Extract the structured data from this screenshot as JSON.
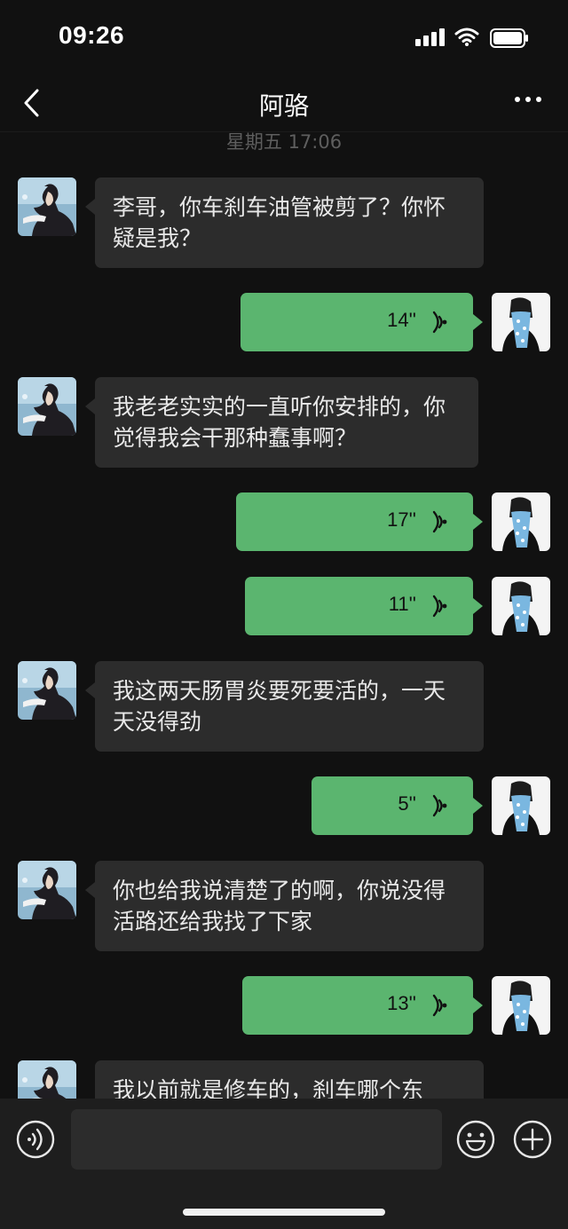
{
  "status_bar": {
    "time": "09:26"
  },
  "header": {
    "title": "阿骆"
  },
  "chat": {
    "timestamp": "星期五 17:06",
    "messages": [
      {
        "side": "left",
        "text": "李哥，你车刹车油管被剪了？你怀疑是我？"
      },
      {
        "side": "right",
        "duration": "14''"
      },
      {
        "side": "left",
        "text": "我老老实实的一直听你安排的，你觉得我会干那种蠢事啊？"
      },
      {
        "side": "right",
        "duration": "17''"
      },
      {
        "side": "right",
        "duration": "11''"
      },
      {
        "side": "left",
        "text": "我这两天肠胃炎要死要活的，一天天没得劲"
      },
      {
        "side": "right",
        "duration": "5''"
      },
      {
        "side": "left",
        "text": "你也给我说清楚了的啊，你说没得活路还给我找了下家"
      },
      {
        "side": "right",
        "duration": "13''"
      },
      {
        "side": "left",
        "text": "我以前就是修车的，刹车哪个东"
      }
    ]
  },
  "input": {
    "placeholder": ""
  },
  "colors": {
    "background": "#111111",
    "incoming_bubble": "#2c2c2c",
    "outgoing_bubble": "#5bb56f",
    "input_bar": "#1e1e1e"
  }
}
